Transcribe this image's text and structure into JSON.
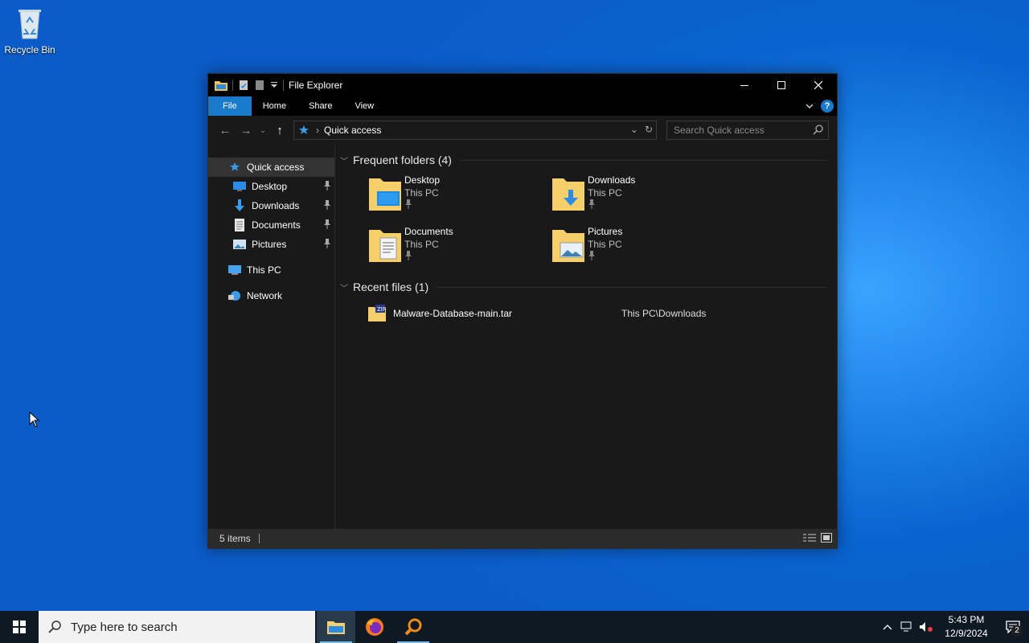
{
  "desktop": {
    "recycle_bin_label": "Recycle Bin"
  },
  "window": {
    "title": "File Explorer",
    "ribbon_tabs": [
      "File",
      "Home",
      "Share",
      "View"
    ],
    "help_label": "?",
    "address_path": "Quick access",
    "search_placeholder": "Search Quick access"
  },
  "nav": {
    "quick_access": "Quick access",
    "pinned": [
      {
        "label": "Desktop",
        "icon": "desktop-icon"
      },
      {
        "label": "Downloads",
        "icon": "downloads-icon"
      },
      {
        "label": "Documents",
        "icon": "documents-icon"
      },
      {
        "label": "Pictures",
        "icon": "pictures-icon"
      }
    ],
    "this_pc": "This PC",
    "network": "Network"
  },
  "content": {
    "frequent_header": "Frequent folders (4)",
    "folders": [
      {
        "name": "Desktop",
        "location": "This PC"
      },
      {
        "name": "Downloads",
        "location": "This PC"
      },
      {
        "name": "Documents",
        "location": "This PC"
      },
      {
        "name": "Pictures",
        "location": "This PC"
      }
    ],
    "recent_header": "Recent files (1)",
    "recent_files": [
      {
        "name": "Malware-Database-main.tar",
        "path": "This PC\\Downloads"
      }
    ]
  },
  "status": {
    "item_count": "5 items"
  },
  "taskbar": {
    "search_placeholder": "Type here to search",
    "apps": [
      "file-explorer",
      "firefox",
      "search-tool"
    ],
    "time": "5:43 PM",
    "date": "12/9/2024",
    "notification_count": "2"
  },
  "colors": {
    "accent": "#1979ca",
    "window_bg": "#191919",
    "taskbar_bg": "#0f1924"
  }
}
